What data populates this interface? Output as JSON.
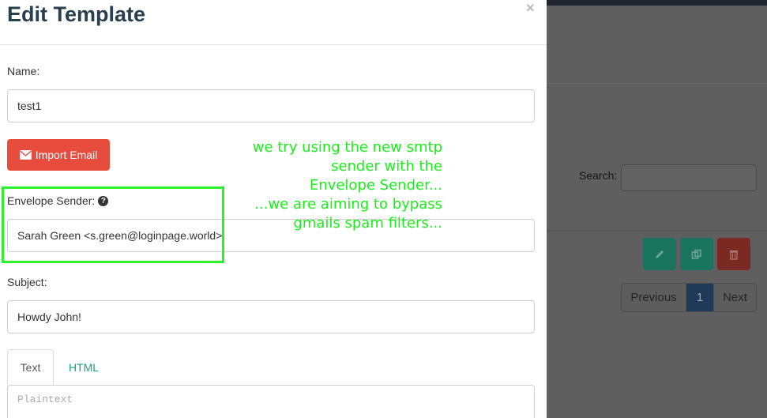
{
  "background": {
    "search_label": "Search:",
    "pagination": {
      "previous": "Previous",
      "current": "1",
      "next": "Next"
    }
  },
  "modal": {
    "title": "Edit Template",
    "close": "×",
    "name_label": "Name:",
    "name_value": "test1",
    "import_button": "Import Email",
    "envelope_label": "Envelope Sender:",
    "envelope_help": "?",
    "envelope_value": "Sarah Green <s.green@loginpage.world>",
    "subject_label": "Subject:",
    "subject_value": "Howdy John!",
    "tabs": [
      {
        "label": "Text"
      },
      {
        "label": "HTML"
      }
    ],
    "plaintext_placeholder": "Plaintext"
  },
  "annotation": {
    "lines": [
      "we try using the new smtp",
      "sender with the",
      "Envelope Sender...",
      "...we are aiming to bypass",
      "gmails spam filters..."
    ],
    "color": "#1aee1a"
  },
  "colors": {
    "import_button": "#e74c3c",
    "accent": "#16a085",
    "title": "#283f50",
    "highlight": "#2bf02b"
  }
}
